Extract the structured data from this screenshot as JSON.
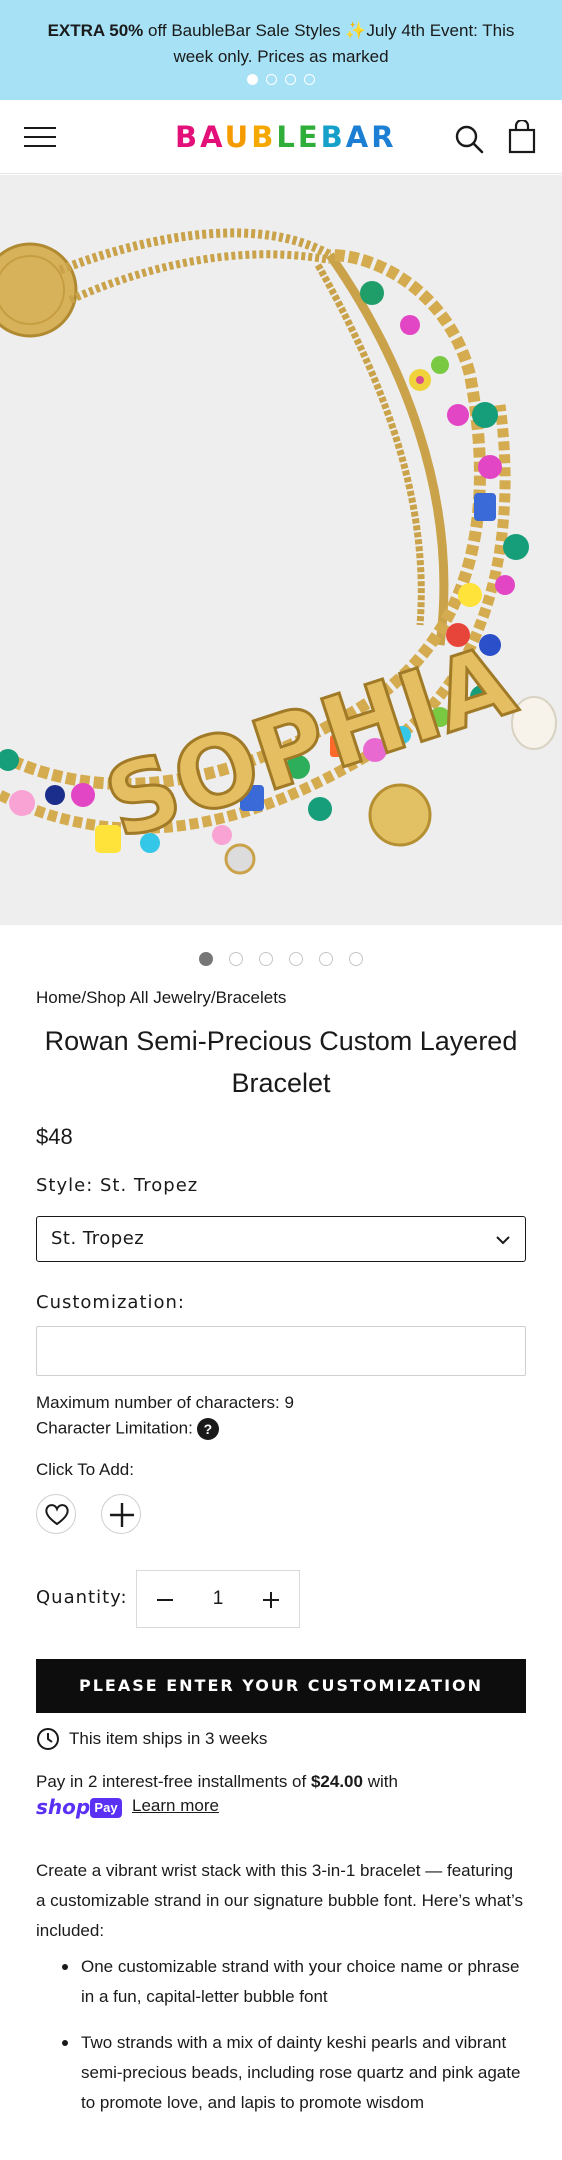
{
  "announcement": {
    "bold": "EXTRA 50%",
    "text": " off BaubleBar Sale Styles ✨July 4th Event: This week only. Prices as marked",
    "slides": 4,
    "active_slide": 1
  },
  "header": {
    "logo_letters": [
      {
        "ch": "B",
        "color": "#e3107a"
      },
      {
        "ch": "A",
        "color": "#e3107a"
      },
      {
        "ch": "U",
        "color": "#f59b00"
      },
      {
        "ch": "B",
        "color": "#f5a800"
      },
      {
        "ch": "L",
        "color": "#2fae3a"
      },
      {
        "ch": "E",
        "color": "#2fae3a"
      },
      {
        "ch": "B",
        "color": "#14a0c8"
      },
      {
        "ch": "A",
        "color": "#1c7fd4"
      },
      {
        "ch": "R",
        "color": "#1c7fd4"
      }
    ],
    "icons": {
      "menu": "hamburger-menu-icon",
      "search": "search-icon",
      "cart": "shopping-bag-icon"
    }
  },
  "gallery": {
    "image_text": "SOPHIA",
    "slides": 6,
    "active_slide": 1
  },
  "product": {
    "breadcrumb": {
      "home": "Home",
      "sep": "/",
      "cat1": "Shop All Jewelry",
      "cat2": "Bracelets"
    },
    "title": "Rowan Semi-Precious Custom Layered Bracelet",
    "price": "$48",
    "style_label": "Style: St. Tropez",
    "style_selected": "St. Tropez",
    "customization_label": "Customization:",
    "customization_value": "",
    "max_chars": "Maximum number of characters: 9",
    "char_limitation": "Character Limitation:",
    "help_icon": "?",
    "click_to_add": "Click To Add:",
    "add_options": [
      "heart-icon",
      "plus-icon"
    ],
    "quantity_label": "Quantity:",
    "quantity": "1",
    "cta": "PLEASE ENTER YOUR CUSTOMIZATION",
    "ships": "This item ships in 3 weeks"
  },
  "shop_pay": {
    "line_start": "Pay in 2 interest-free installments of ",
    "amount": "$24.00",
    "line_end": " with",
    "shop_word": "shop",
    "pay_word": "Pay",
    "learn_more": "Learn more",
    "brand_color": "#5a31f4"
  },
  "description": {
    "intro": "Create a vibrant wrist stack with this 3-in-1 bracelet — featuring a customizable strand in our signature bubble font. Here’s what’s included:",
    "bullets": [
      "One customizable strand with your choice name or phrase in a fun, capital-letter bubble font",
      "Two strands with a mix of dainty keshi pearls and vibrant semi-precious beads, including rose quartz and pink agate to promote love, and lapis to promote wisdom"
    ]
  }
}
